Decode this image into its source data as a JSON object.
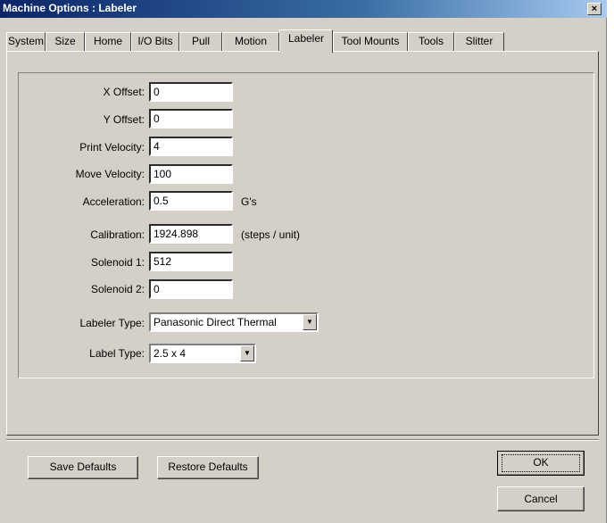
{
  "window": {
    "title": "Machine Options : Labeler",
    "close_glyph": "×"
  },
  "tabs": [
    {
      "label": "System"
    },
    {
      "label": "Size"
    },
    {
      "label": "Home"
    },
    {
      "label": "I/O Bits"
    },
    {
      "label": "Pull"
    },
    {
      "label": "Motion"
    },
    {
      "label": "Labeler",
      "active": true
    },
    {
      "label": "Tool Mounts"
    },
    {
      "label": "Tools"
    },
    {
      "label": "Slitter"
    }
  ],
  "fields": {
    "x_offset": {
      "label": "X Offset:",
      "value": "0"
    },
    "y_offset": {
      "label": "Y Offset:",
      "value": "0"
    },
    "print_velocity": {
      "label": "Print Velocity:",
      "value": "4"
    },
    "move_velocity": {
      "label": "Move Velocity:",
      "value": "100"
    },
    "acceleration": {
      "label": "Acceleration:",
      "value": "0.5",
      "unit": "G's"
    },
    "calibration": {
      "label": "Calibration:",
      "value": "1924.898",
      "unit": "(steps / unit)"
    },
    "solenoid1": {
      "label": "Solenoid 1:",
      "value": "512"
    },
    "solenoid2": {
      "label": "Solenoid 2:",
      "value": "0"
    }
  },
  "labeler_type": {
    "label": "Labeler Type:",
    "value": "Panasonic Direct Thermal"
  },
  "label_type": {
    "label": "Label Type:",
    "value": "2.5 x 4"
  },
  "buttons": {
    "save_defaults": "Save Defaults",
    "restore_defaults": "Restore Defaults",
    "ok": "OK",
    "cancel": "Cancel"
  },
  "icons": {
    "dropdown": "dropdown-arrow-icon",
    "close": "close-icon"
  }
}
